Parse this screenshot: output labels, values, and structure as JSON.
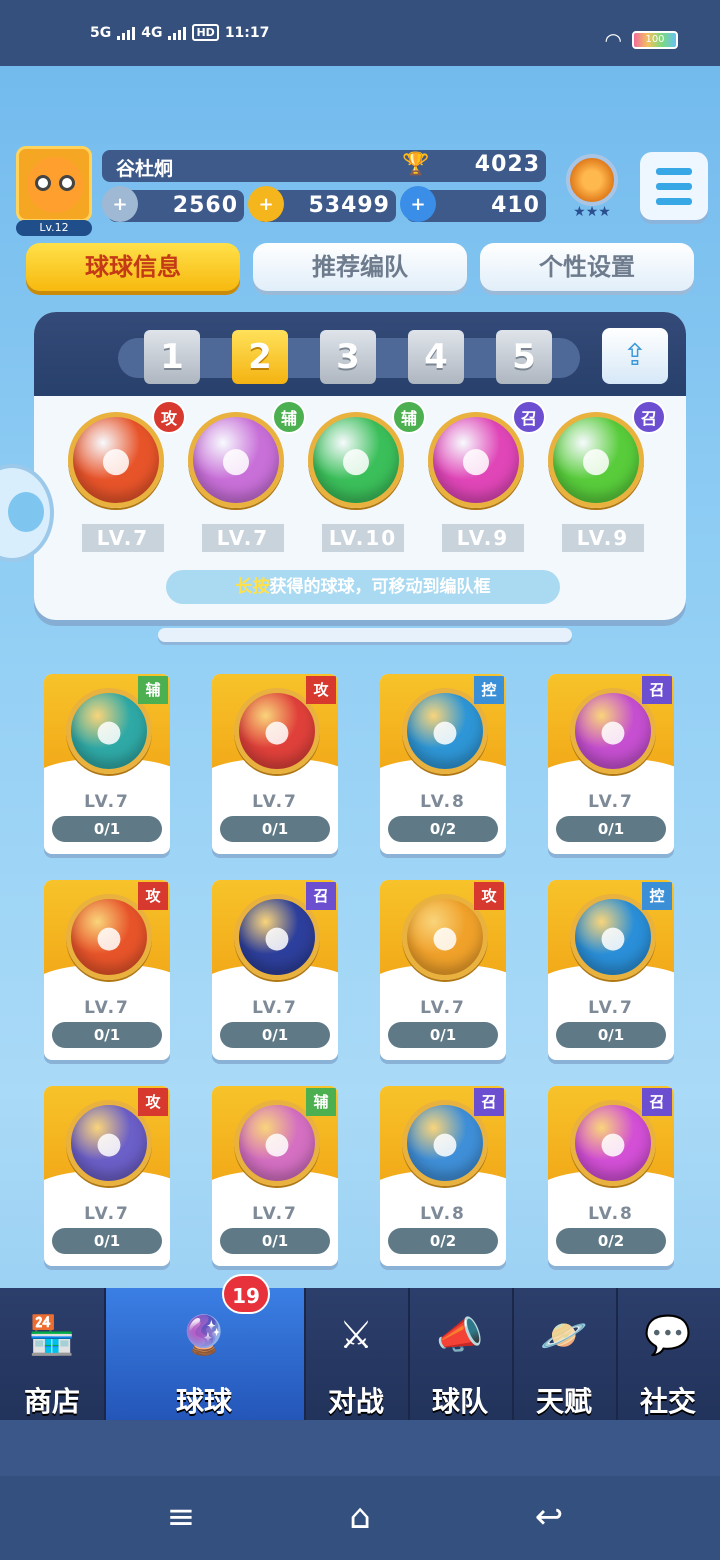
{
  "status_bar": {
    "net1": "5G",
    "net2": "4G",
    "hd": "HD",
    "time": "11:17",
    "battery": "100"
  },
  "player": {
    "name": "谷杜炯",
    "level": "Lv.12",
    "trophies": "4023",
    "silver": "2560",
    "gold": "53499",
    "gems": "410"
  },
  "tabs": [
    "球球信息",
    "推荐编队",
    "个性设置"
  ],
  "team_slots": [
    "1",
    "2",
    "3",
    "4",
    "5"
  ],
  "active_slot": 2,
  "team": [
    {
      "type": "攻",
      "level": "LV.7",
      "color": "#e8542a",
      "badge_color": "#d8392e",
      "icon": "fist-icon"
    },
    {
      "type": "辅",
      "level": "LV.7",
      "color": "#c86fd8",
      "badge_color": "#4caf50",
      "icon": "people-icon"
    },
    {
      "type": "辅",
      "level": "LV.10",
      "color": "#3bbf5a",
      "badge_color": "#4caf50",
      "icon": "arrow-up-icon"
    },
    {
      "type": "召",
      "level": "LV.9",
      "color": "#e046b8",
      "badge_color": "#6c4fd0",
      "icon": "feather-icon"
    },
    {
      "type": "召",
      "level": "LV.9",
      "color": "#58cc3b",
      "badge_color": "#6c4fd0",
      "icon": "star-icon"
    }
  ],
  "hint": {
    "highlight": "长按",
    "text": "获得的球球，可移动到编队框"
  },
  "balls": [
    {
      "type": "辅",
      "level": "LV.7",
      "count": "0/1",
      "color": "#2fa9a6",
      "tag_color": "#4caf50",
      "icon": "dragon-icon"
    },
    {
      "type": "攻",
      "level": "LV.7",
      "count": "0/1",
      "color": "#e0403a",
      "tag_color": "#d8392e",
      "icon": "phoenix-fire-icon"
    },
    {
      "type": "控",
      "level": "LV.8",
      "count": "0/2",
      "color": "#2e96d6",
      "tag_color": "#3a8fd6",
      "icon": "swirl-icon"
    },
    {
      "type": "召",
      "level": "LV.7",
      "count": "0/1",
      "color": "#c54fd0",
      "tag_color": "#6c4fd0",
      "icon": "phoenix-icon"
    },
    {
      "type": "攻",
      "level": "LV.7",
      "count": "0/1",
      "color": "#e8542a",
      "tag_color": "#d8392e",
      "icon": "fist-icon"
    },
    {
      "type": "召",
      "level": "LV.7",
      "count": "0/1",
      "color": "#2d3f9c",
      "tag_color": "#6c4fd0",
      "icon": "blackhole-icon"
    },
    {
      "type": "攻",
      "level": "LV.7",
      "count": "0/1",
      "color": "#f0a12a",
      "tag_color": "#d8392e",
      "icon": "knight-icon"
    },
    {
      "type": "控",
      "level": "LV.7",
      "count": "0/1",
      "color": "#2a8fd8",
      "tag_color": "#3a8fd6",
      "icon": "wave-icon"
    },
    {
      "type": "攻",
      "level": "LV.7",
      "count": "0/1",
      "color": "#6b5fc8",
      "tag_color": "#d8392e",
      "icon": "block-icon"
    },
    {
      "type": "辅",
      "level": "LV.7",
      "count": "0/1",
      "color": "#d46fc2",
      "tag_color": "#4caf50",
      "icon": "people-icon"
    },
    {
      "type": "召",
      "level": "LV.8",
      "count": "0/2",
      "color": "#3f8fd8",
      "tag_color": "#6c4fd0",
      "icon": "tornado-icon"
    },
    {
      "type": "召",
      "level": "LV.8",
      "count": "0/2",
      "color": "#d24fd6",
      "tag_color": "#6c4fd0",
      "icon": "mushroom-cloud-icon"
    }
  ],
  "nav": [
    {
      "label": "商店",
      "icon": "shop-icon",
      "glyph": "🏪"
    },
    {
      "label": "球球",
      "icon": "ball-icon",
      "glyph": "🔮",
      "badge": "19"
    },
    {
      "label": "对战",
      "icon": "swords-icon",
      "glyph": "⚔"
    },
    {
      "label": "球队",
      "icon": "whistle-icon",
      "glyph": "📣"
    },
    {
      "label": "天赋",
      "icon": "planet-icon",
      "glyph": "🪐"
    },
    {
      "label": "社交",
      "icon": "chat-icon",
      "glyph": "💬"
    }
  ],
  "system_nav": [
    "menu-icon",
    "home-icon",
    "back-icon"
  ]
}
